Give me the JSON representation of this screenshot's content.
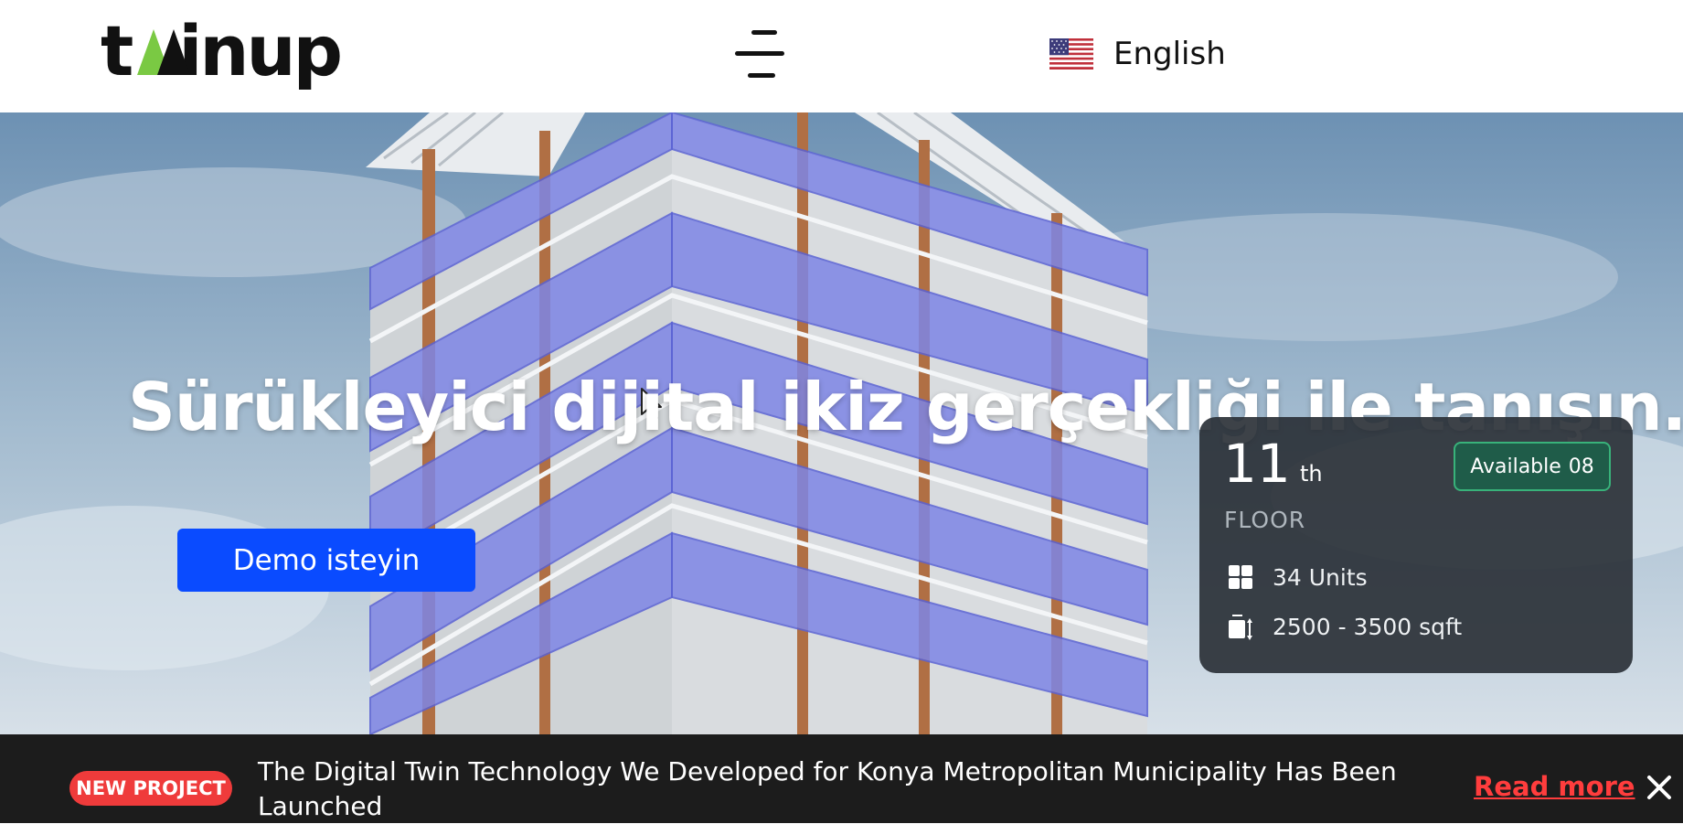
{
  "header": {
    "logo_text": "twinup",
    "menu_icon": "hamburger-menu-icon",
    "language": {
      "flag_icon": "us-flag-icon",
      "label": "English"
    }
  },
  "hero": {
    "headline": "Sürükleyici dijital ikiz gerçekliği ile tanışın.",
    "cta_label": "Demo isteyin",
    "floor_card": {
      "floor_number": "11",
      "floor_suffix": "th",
      "floor_label": "FLOOR",
      "available_label": "Available",
      "available_count": "08",
      "units_icon": "grid-icon",
      "units_text": "34 Units",
      "area_icon": "area-icon",
      "area_text": "2500 - 3500 sqft"
    }
  },
  "announcement": {
    "badge": "NEW PROJECT",
    "text": "The Digital Twin Technology We Developed for Konya Metropolitan Municipality Has Been Launched",
    "read_more": "Read more",
    "close_icon": "close-icon"
  },
  "colors": {
    "cta": "#0a4bff",
    "badge_red": "#ef3b3b",
    "read_more": "#ff3d3d",
    "banner_bg": "#1c1c1c",
    "logo_accent": "#7ac943",
    "building_highlight": "#7e86e6"
  }
}
